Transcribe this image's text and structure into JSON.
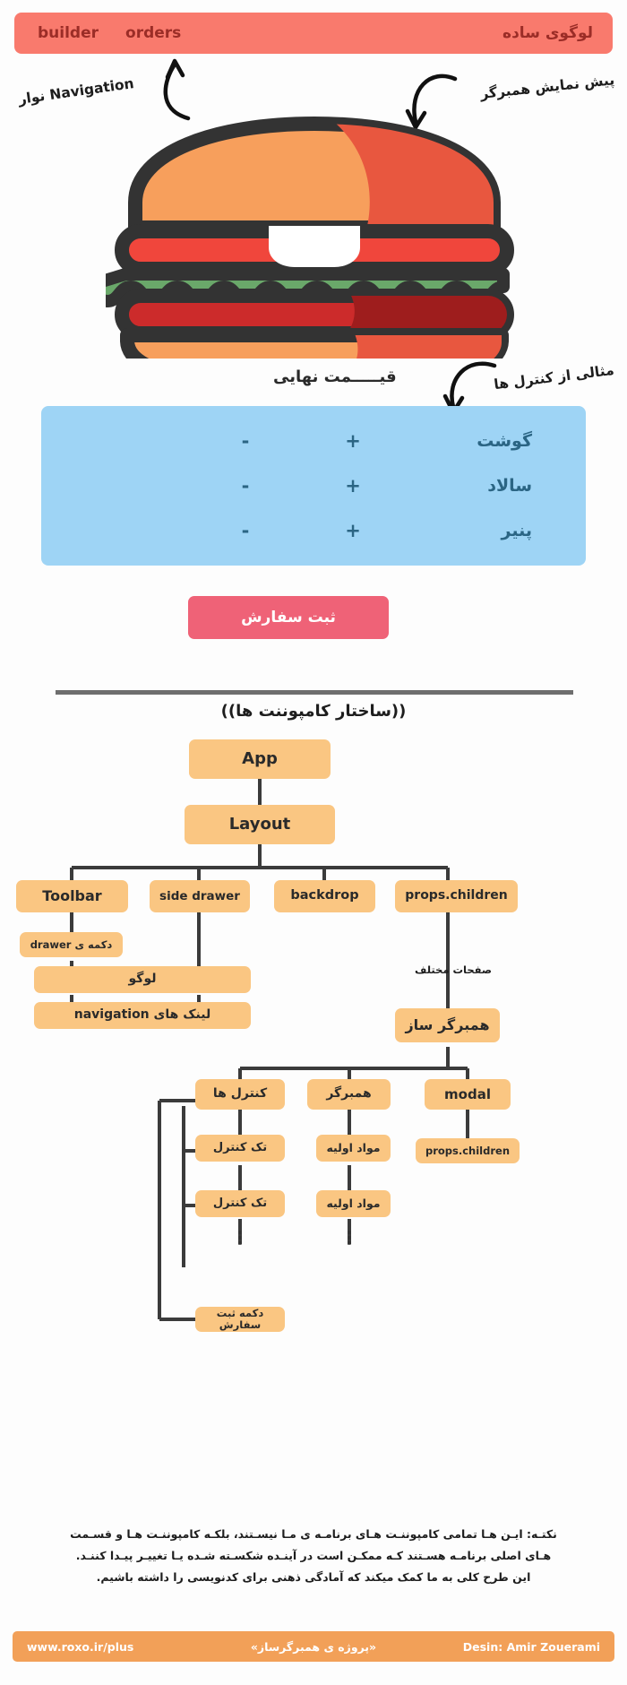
{
  "navbar": {
    "logo": "لوگوی ساده",
    "links": [
      {
        "label": "builder"
      },
      {
        "label": "orders"
      }
    ]
  },
  "annotations": {
    "nav": "نوار Navigation",
    "preview": "پیش نمایش همبرگر",
    "controls": "مثالی از کنترل ها",
    "price": "قیـــــمت نهایی"
  },
  "controls_panel": {
    "rows": [
      {
        "name": "گوشت",
        "plus": "+",
        "minus": "-"
      },
      {
        "name": "سالاد",
        "plus": "+",
        "minus": "-"
      },
      {
        "name": "پنیر",
        "plus": "+",
        "minus": "-"
      }
    ]
  },
  "order_button": {
    "label": "ثبت سفارش"
  },
  "tree": {
    "title": "((ساختار کامپوننت ها))",
    "nodes": {
      "app": "App",
      "layout": "Layout",
      "toolbar": "Toolbar",
      "side_drawer": "side drawer",
      "backdrop": "backdrop",
      "props_children": "props.children",
      "drawer_button": "دکمه ی drawer",
      "logo": "لوگو",
      "nav_links": "لینک های navigation",
      "burger_builder": "همبرگر ساز",
      "controls": "کنترل ها",
      "burger": "همبرگر",
      "modal": "modal",
      "single_control_1": "تک کنترل",
      "single_control_2": "تک کنترل",
      "ingredient_1": "مواد اولیه",
      "ingredient_2": "مواد اولیه",
      "modal_children": "props.children",
      "order_button": "دکمه ثبت سفارش"
    },
    "labels": {
      "pages": "صفحات مختلف"
    },
    "ellipsis": "⋮"
  },
  "footnote": {
    "line1": "نکتـه: ایـن هـا تمامی کامپوننـت هـای برنامـه ی مـا نیسـتند، بلکـه کامپوننـت هـا و قسـمت",
    "line2": "هـای اصلی برنامـه هسـتند کـه ممکـن است در آینـده شکسـته شـده یـا تغییـر پیـدا کننـد.",
    "line3": "این طرح کلی به ما کمک میکند که آمادگی ذهنی برای کدنویسی را داشته باشیم."
  },
  "footer": {
    "left": "www.roxo.ir/plus",
    "center": "«پروژه ی همبرگرساز»",
    "right": "Desin: Amir Zouerami"
  },
  "colors": {
    "nav_bg": "#f97a6d",
    "nav_text": "#9b2d27",
    "controls_bg": "#9ed4f5",
    "controls_text": "#2b6584",
    "order_btn_bg": "#ef6277",
    "node_bg": "#fac682",
    "footer_bg": "#f2a058",
    "bun_light": "#f79f5c",
    "bun_dark": "#e8573f",
    "tomato": "#f0463c",
    "lettuce": "#6aa86a",
    "meat": "#cc2b2b",
    "outline": "#333333"
  }
}
